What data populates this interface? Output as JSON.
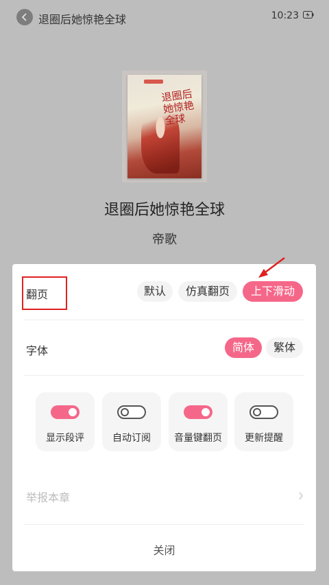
{
  "topbar": {
    "book_title": "退圈后她惊艳全球",
    "time": "10:23"
  },
  "cover": {
    "art_title": "退圈后她惊艳全球"
  },
  "book": {
    "title": "退圈后她惊艳全球",
    "author": "帝歌"
  },
  "settings": {
    "page_turn": {
      "label": "翻页",
      "options": [
        "默认",
        "仿真翻页",
        "上下滑动"
      ],
      "selected": "上下滑动"
    },
    "font": {
      "label": "字体",
      "options": [
        "简体",
        "繁体"
      ],
      "selected": "简体"
    },
    "toggles": [
      {
        "label": "显示段评",
        "on": true
      },
      {
        "label": "自动订阅",
        "on": false
      },
      {
        "label": "音量键翻页",
        "on": true
      },
      {
        "label": "更新提醒",
        "on": false
      }
    ],
    "report_label": "举报本章",
    "close_label": "关闭"
  },
  "colors": {
    "accent": "#f56789",
    "annotation": "#e02020",
    "overlay_bg": "#bdbdbd"
  }
}
